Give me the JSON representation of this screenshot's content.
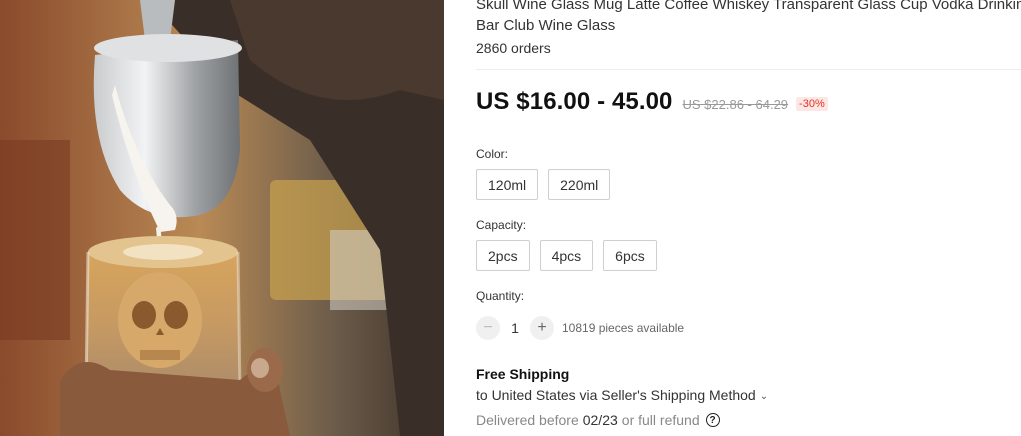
{
  "product": {
    "title": "Skull Wine Glass Mug Latte Coffee Whiskey Transparent Glass Cup Vodka Drinking Bar Club Wine Glass",
    "orders": "2860 orders",
    "image_description_icon": "latte-art-skull-glass-photo"
  },
  "price": {
    "current": "US $16.00 - 45.00",
    "original": "US $22.86 - 64.29",
    "discount": "-30%"
  },
  "color": {
    "label": "Color:",
    "options": [
      "120ml",
      "220ml"
    ]
  },
  "capacity": {
    "label": "Capacity:",
    "options": [
      "2pcs",
      "4pcs",
      "6pcs"
    ]
  },
  "quantity": {
    "label": "Quantity:",
    "minus": "−",
    "value": "1",
    "plus": "+",
    "available": "10819 pieces available"
  },
  "shipping": {
    "title": "Free Shipping",
    "destination": "to United States via Seller's Shipping Method",
    "chevron_icon": "chevron-down-icon",
    "delivered_prefix": "Delivered before",
    "delivered_date": "02/23",
    "delivered_suffix": "or full refund",
    "help_icon": "question-circle-icon",
    "help_glyph": "?"
  },
  "colors": {
    "discount_text": "#e43225",
    "discount_bg": "#fde7e5"
  }
}
